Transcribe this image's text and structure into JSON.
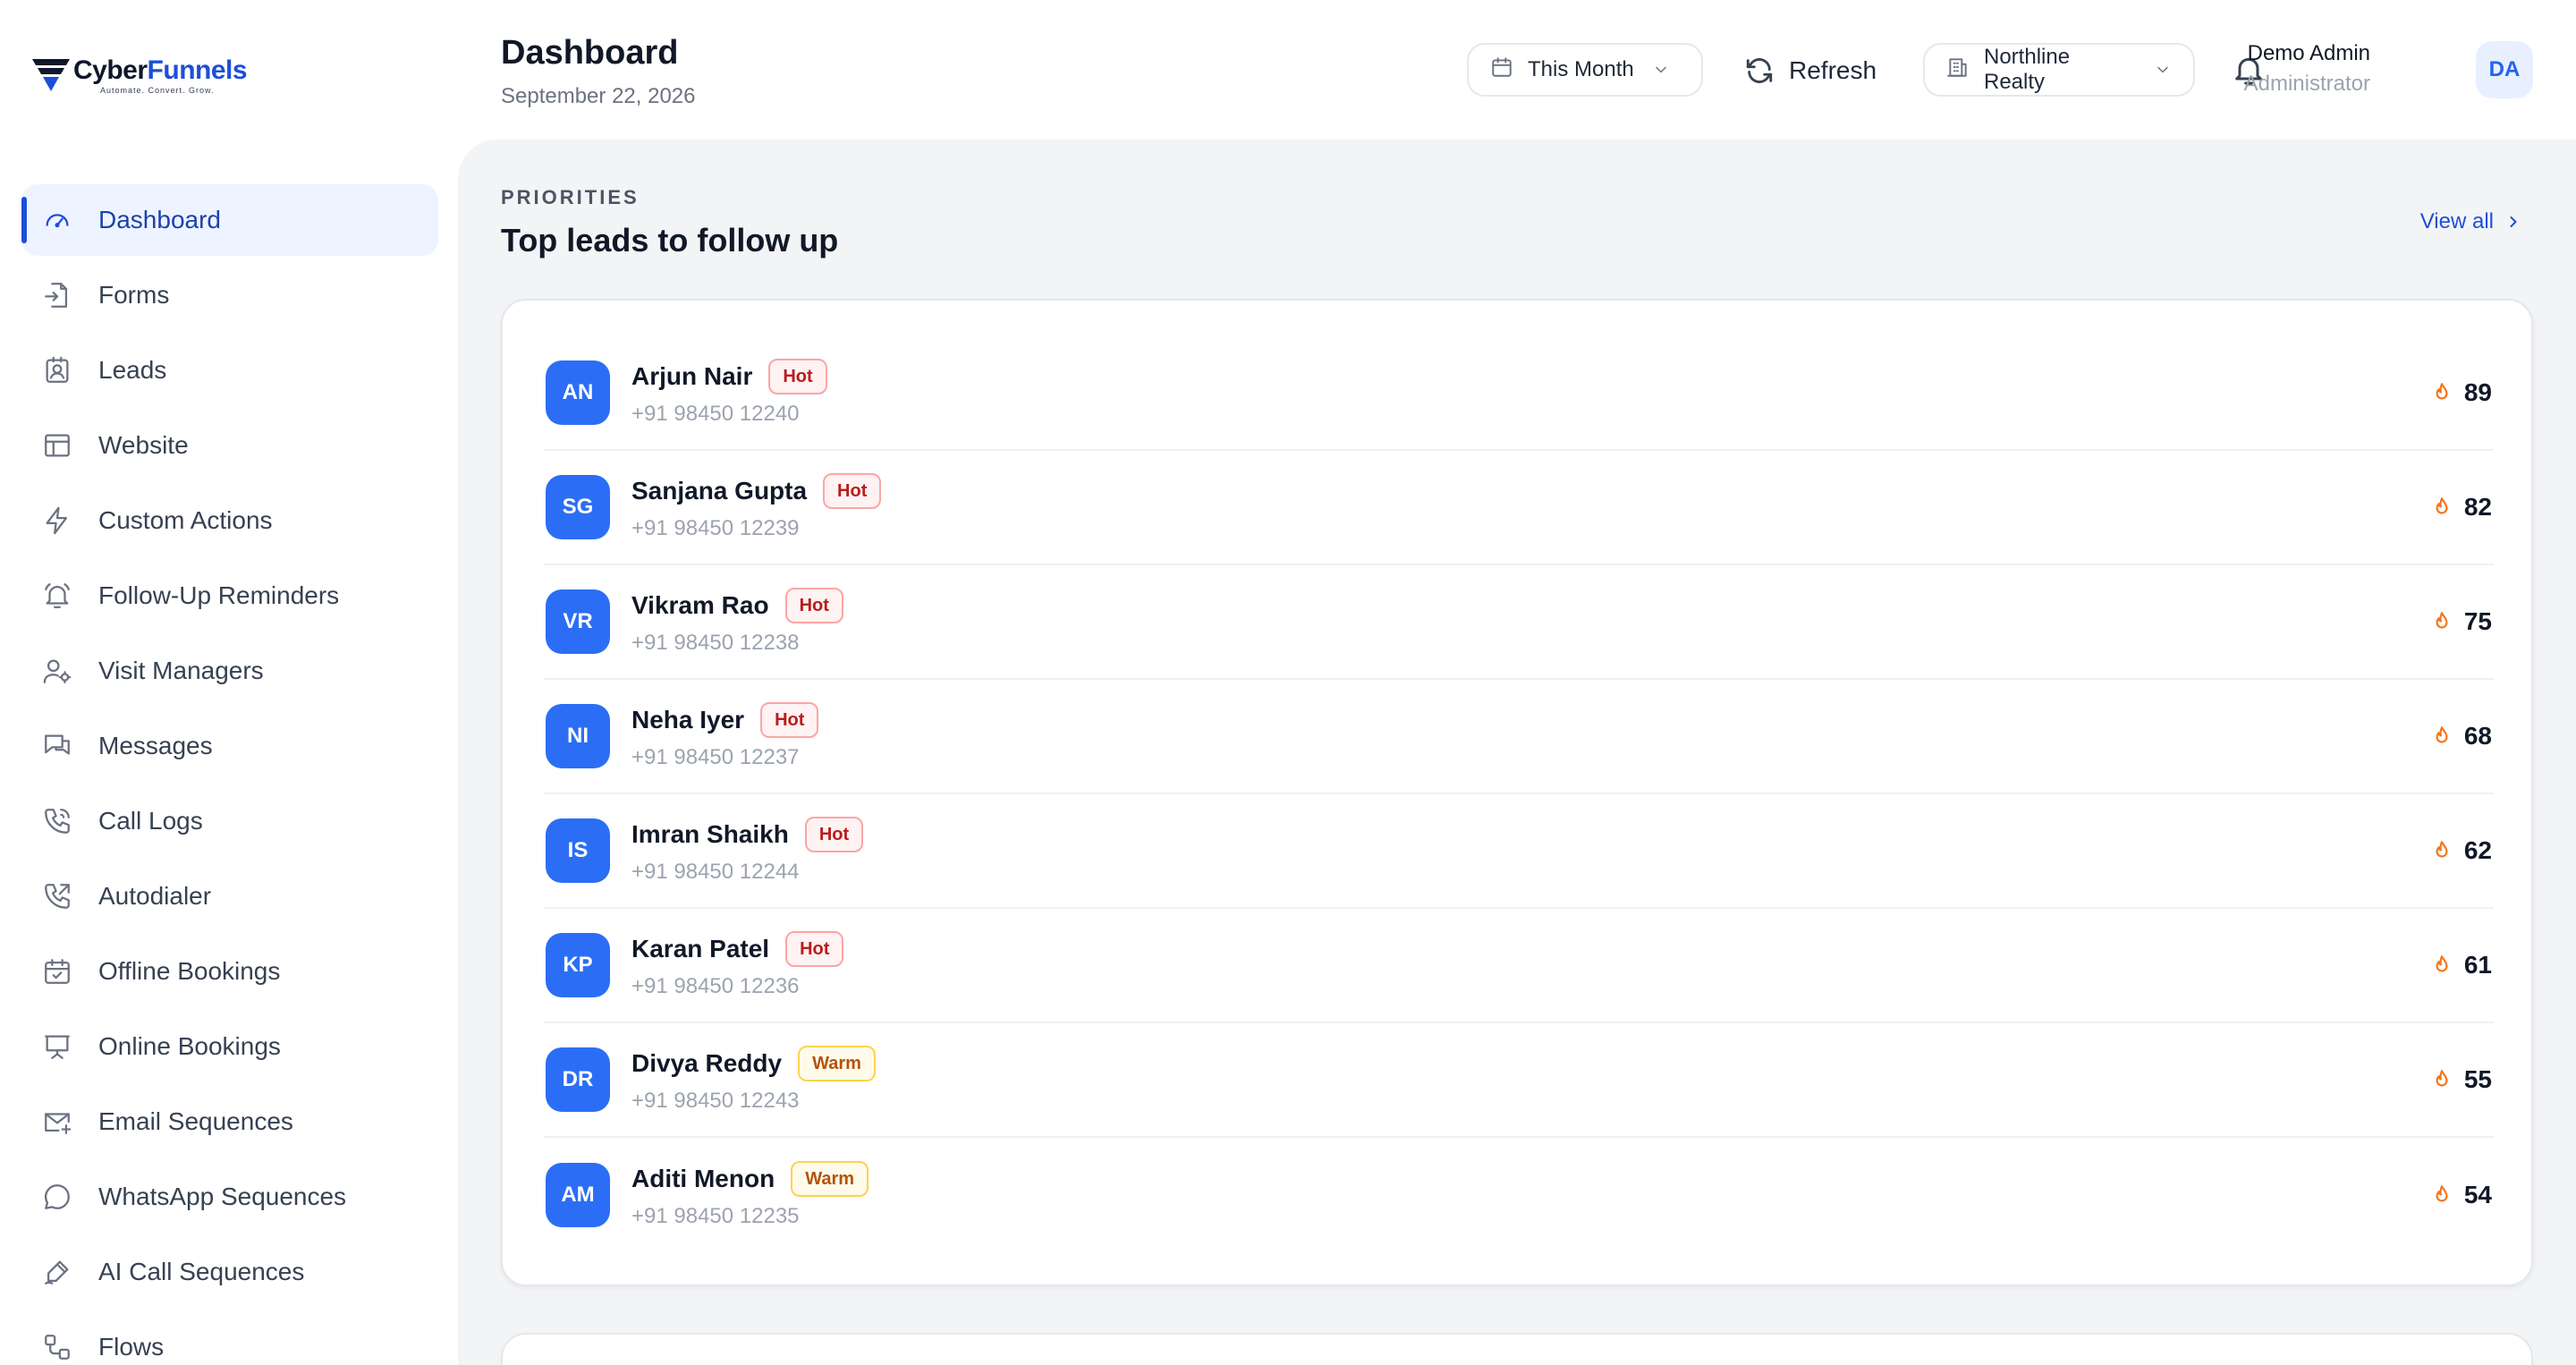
{
  "brand": {
    "name_part1": "Cyber",
    "name_part2": "Funnels",
    "tagline": "Automate. Convert. Grow."
  },
  "sidebar": {
    "items": [
      {
        "label": "Dashboard",
        "icon": "gauge-icon",
        "active": true
      },
      {
        "label": "Forms",
        "icon": "form-import-icon"
      },
      {
        "label": "Leads",
        "icon": "contact-card-icon"
      },
      {
        "label": "Website",
        "icon": "layout-icon"
      },
      {
        "label": "Custom Actions",
        "icon": "lightning-icon"
      },
      {
        "label": "Follow-Up Reminders",
        "icon": "bell-ring-icon"
      },
      {
        "label": "Visit Managers",
        "icon": "user-gear-icon"
      },
      {
        "label": "Messages",
        "icon": "chat-bubbles-icon"
      },
      {
        "label": "Call Logs",
        "icon": "phone-waves-icon"
      },
      {
        "label": "Autodialer",
        "icon": "phone-outgoing-icon"
      },
      {
        "label": "Offline Bookings",
        "icon": "calendar-check-icon"
      },
      {
        "label": "Online Bookings",
        "icon": "presentation-icon"
      },
      {
        "label": "Email Sequences",
        "icon": "mail-plus-icon"
      },
      {
        "label": "WhatsApp Sequences",
        "icon": "chat-round-icon"
      },
      {
        "label": "AI Call Sequences",
        "icon": "pen-signal-icon"
      },
      {
        "label": "Flows",
        "icon": "flow-icon"
      }
    ]
  },
  "header": {
    "title": "Dashboard",
    "date": "September 22, 2026",
    "period_label": "This Month",
    "refresh_label": "Refresh",
    "org_label": "Northline Realty",
    "user_name": "Demo Admin",
    "user_role": "Administrator",
    "user_initials": "DA"
  },
  "priorities": {
    "eyebrow": "PRIORITIES",
    "title": "Top leads to follow up",
    "view_all": "View all",
    "leads": [
      {
        "initials": "AN",
        "name": "Arjun Nair",
        "badge": "Hot",
        "phone": "+91 98450 12240",
        "score": "89"
      },
      {
        "initials": "SG",
        "name": "Sanjana Gupta",
        "badge": "Hot",
        "phone": "+91 98450 12239",
        "score": "82"
      },
      {
        "initials": "VR",
        "name": "Vikram Rao",
        "badge": "Hot",
        "phone": "+91 98450 12238",
        "score": "75"
      },
      {
        "initials": "NI",
        "name": "Neha Iyer",
        "badge": "Hot",
        "phone": "+91 98450 12237",
        "score": "68"
      },
      {
        "initials": "IS",
        "name": "Imran Shaikh",
        "badge": "Hot",
        "phone": "+91 98450 12244",
        "score": "62"
      },
      {
        "initials": "KP",
        "name": "Karan Patel",
        "badge": "Hot",
        "phone": "+91 98450 12236",
        "score": "61"
      },
      {
        "initials": "DR",
        "name": "Divya Reddy",
        "badge": "Warm",
        "phone": "+91 98450 12243",
        "score": "55"
      },
      {
        "initials": "AM",
        "name": "Aditi Menon",
        "badge": "Warm",
        "phone": "+91 98450 12235",
        "score": "54"
      }
    ]
  },
  "colors": {
    "accent": "#1d4ed8",
    "avatar": "#2b6ef5",
    "hot": "#b91c1c",
    "warm": "#b45309",
    "flame": "#f97316"
  }
}
